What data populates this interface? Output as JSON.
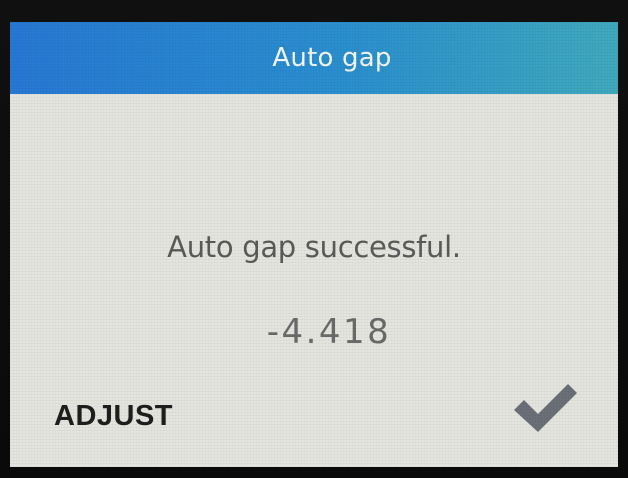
{
  "header": {
    "title": "Auto gap"
  },
  "main": {
    "message": "Auto gap successful.",
    "value": "-4.418"
  },
  "footer": {
    "adjust_label": "ADJUST",
    "confirm_icon": "checkmark-icon"
  },
  "colors": {
    "title_bar_start": "#2778d3",
    "title_bar_end": "#3fa9bd",
    "screen_background": "#e5e5df",
    "checkmark": "#6b6f78"
  }
}
